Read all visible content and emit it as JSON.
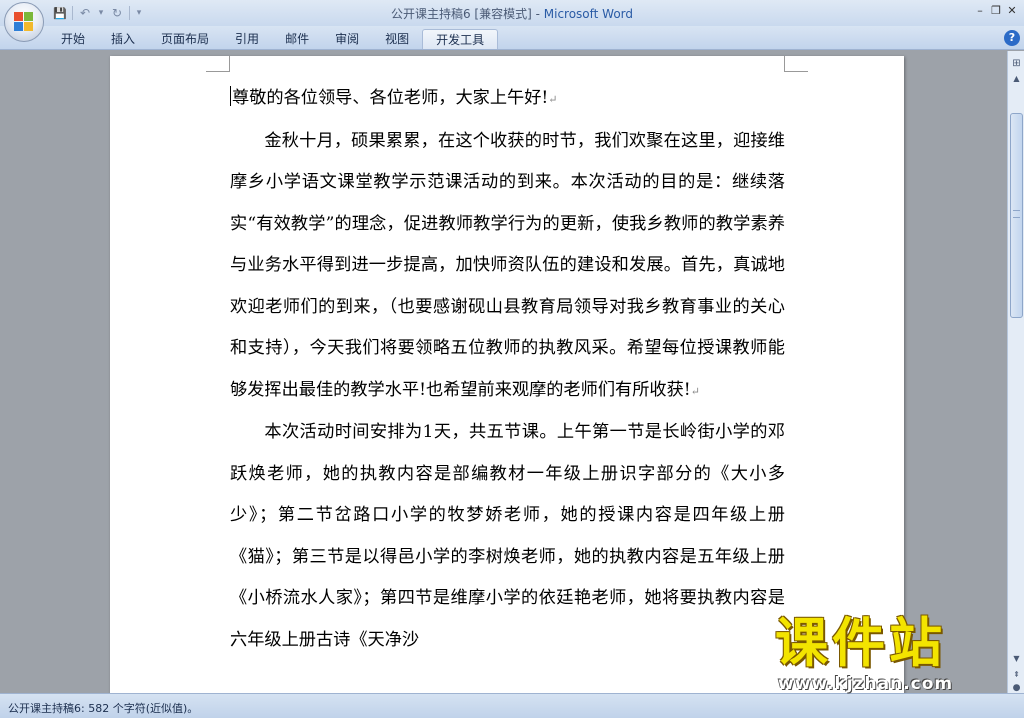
{
  "window": {
    "doc_title": "公开课主持稿6 [兼容模式]",
    "separator": " - ",
    "app_name": "Microsoft Word",
    "minimize": "–",
    "restore": "❐"
  },
  "quick_access": {
    "save_icon": "💾",
    "undo_icon": "↶",
    "redo_icon": "↻",
    "customize_icon": "▾"
  },
  "ribbon": {
    "tabs": [
      "开始",
      "插入",
      "页面布局",
      "引用",
      "邮件",
      "审阅",
      "视图",
      "开发工具"
    ],
    "active_tab": "开发工具",
    "help": "?"
  },
  "document": {
    "paragraphs": [
      "尊敬的各位领导、各位老师，大家上午好!",
      "金秋十月，硕果累累，在这个收获的时节，我们欢聚在这里，迎接维摩乡小学语文课堂教学示范课活动的到来。本次活动的目的是：继续落实“有效教学”的理念，促进教师教学行为的更新，使我乡教师的教学素养与业务水平得到进一步提高，加快师资队伍的建设和发展。首先，真诚地欢迎老师们的到来，（也要感谢砚山县教育局领导对我乡教育事业的关心和支持），今天我们将要领略五位教师的执教风采。希望每位授课教师能够发挥出最佳的教学水平!也希望前来观摩的老师们有所收获!",
      "本次活动时间安排为1天，共五节课。上午第一节是长岭街小学的邓跃焕老师，她的执教内容是部编教材一年级上册识字部分的《大小多少》；第二节岔路口小学的牧梦娇老师，她的授课内容是四年级上册《猫》；第三节是以得邑小学的李树焕老师，她的执教内容是五年级上册《小桥流水人家》；第四节是维摩小学的依廷艳老师，她将要执教内容是六年级上册古诗《天净沙"
    ],
    "paragraph_mark": "↵"
  },
  "scrollbar": {
    "ruler_icon": "⊞",
    "up": "▲",
    "down": "▼",
    "prev": "⇞",
    "browse": "●"
  },
  "status": {
    "word_count": "公开课主持稿6: 582 个字符(近似值)。"
  },
  "watermark": {
    "brand": "课件站",
    "url": "www.kjzhan.com"
  },
  "colors": {
    "app_title": "#2a5ba5",
    "watermark": "#f3e400"
  }
}
